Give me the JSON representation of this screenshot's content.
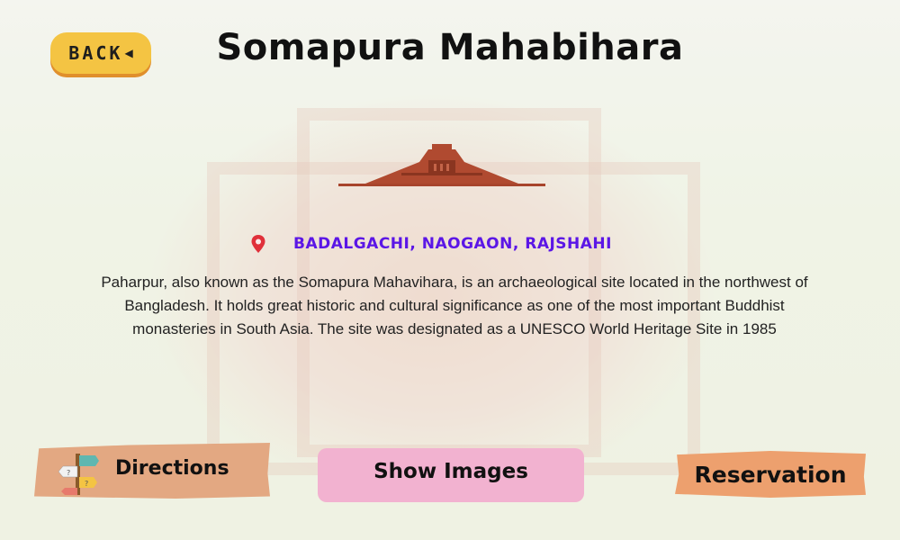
{
  "header": {
    "back_label": "BACK",
    "title": "Somapura Mahabihara"
  },
  "site": {
    "location": "BADALGACHI, NAOGAON, RAJSHAHI",
    "description": "Paharpur, also known as the Somapura Mahavihara, is an archaeological site located in the northwest of Bangladesh. It holds great historic and cultural significance as one of the most important Buddhist monasteries in South Asia. The site was designated as a UNESCO World Heritage Site in 1985"
  },
  "actions": {
    "directions_label": "Directions",
    "show_images_label": "Show Images",
    "reservation_label": "Reservation"
  },
  "icons": {
    "back": "left-triangle-icon",
    "location": "map-pin-icon",
    "monument": "temple-icon",
    "directions": "signpost-icon"
  },
  "colors": {
    "back_button": "#f4c443",
    "location_text": "#5b16e6",
    "location_pin": "#e0303a",
    "temple": "#a8442c",
    "directions_button": "#e3a882",
    "show_images_button": "#f2b2d0",
    "reservation_button": "#eda06e"
  }
}
